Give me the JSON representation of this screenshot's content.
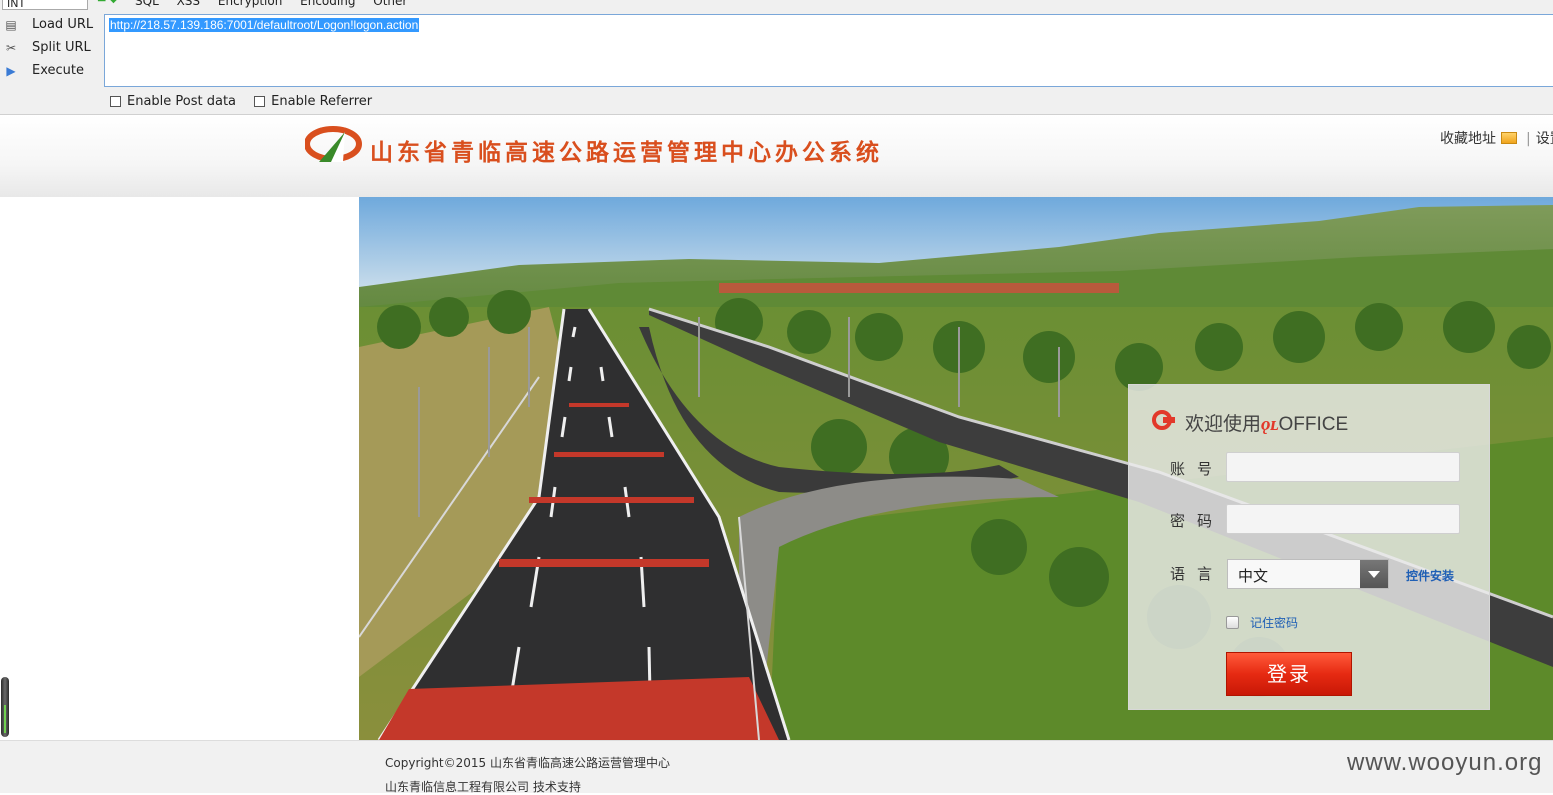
{
  "toolbar": {
    "dropdown_value": "INT",
    "menu": [
      "SQL",
      "XSS",
      "Encryption",
      "Encoding",
      "Other"
    ],
    "actions": [
      {
        "label": "Load URL",
        "icon": "load-url-icon"
      },
      {
        "label": "Split URL",
        "icon": "scissors-icon"
      },
      {
        "label": "Execute",
        "icon": "play-icon"
      }
    ],
    "url": "http://218.57.139.186:7001/defaultroot/Logon!logon.action",
    "options": [
      "Enable Post data",
      "Enable Referrer"
    ]
  },
  "header": {
    "title": "山东省青临高速公路运营管理中心办公系统",
    "favorites_label": "收藏地址",
    "separator": "|",
    "settings_label": "设置"
  },
  "login": {
    "welcome": "欢迎使用",
    "brand": "ǫʟ",
    "brand_suffix": "OFFICE",
    "account_label": "账号",
    "password_label": "密码",
    "language_label": "语言",
    "language_value": "中文",
    "install_link": "控件安装",
    "remember_label": "记住密码",
    "login_button": "登录"
  },
  "footer": {
    "line1": "Copyright©2015 山东省青临高速公路运营管理中心",
    "line2": "山东青临信息工程有限公司 技术支持",
    "watermark": "www.wooyun.org"
  },
  "colors": {
    "title": "#d94f1e",
    "login_button": "#e62a12",
    "link": "#1f5fb5",
    "url_highlight": "#3399ff"
  }
}
